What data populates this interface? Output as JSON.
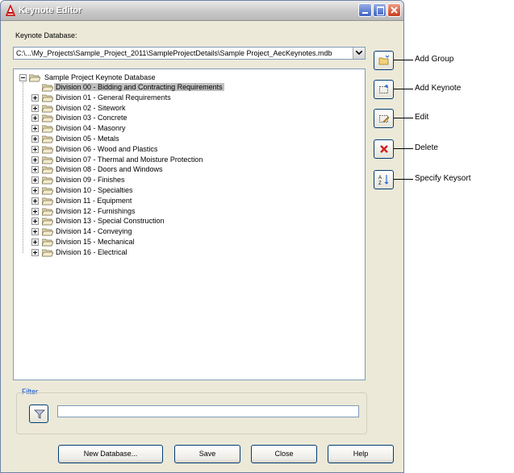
{
  "window": {
    "title": "Keynote Editor"
  },
  "database": {
    "label": "Keynote Database:",
    "path": "C:\\...\\My_Projects\\Sample_Project_2011\\SampleProjectDetails\\Sample Project_AecKeynotes.mdb"
  },
  "tree": {
    "root": "Sample Project Keynote Database",
    "items": [
      "Division 00 - Bidding and Contracting Requirements",
      "Division 01 - General Requirements",
      "Division 02 - Sitework",
      "Division 03 - Concrete",
      "Division 04 - Masonry",
      "Division 05 - Metals",
      "Division 06 - Wood and Plastics",
      "Division 07 - Thermal and Moisture Protection",
      "Division 08 - Doors and Windows",
      "Division 09 - Finishes",
      "Division 10 - Specialties",
      "Division 11 - Equipment",
      "Division 12 - Furnishings",
      "Division 13 - Special Construction",
      "Division 14 - Conveying",
      "Division 15 - Mechanical",
      "Division 16 - Electrical"
    ]
  },
  "callouts": {
    "add_group": "Add Group",
    "add_keynote": "Add Keynote",
    "edit": "Edit",
    "delete": "Delete",
    "specify_keysort": "Specify Keysort"
  },
  "filter": {
    "legend": "Filter",
    "value": "",
    "placeholder": ""
  },
  "buttons": {
    "new_database": "New Database...",
    "save": "Save",
    "close": "Close",
    "help": "Help"
  },
  "colors": {
    "accent": "#0046d5",
    "selection": "#c0c0c0",
    "window": "#ece9d8"
  }
}
